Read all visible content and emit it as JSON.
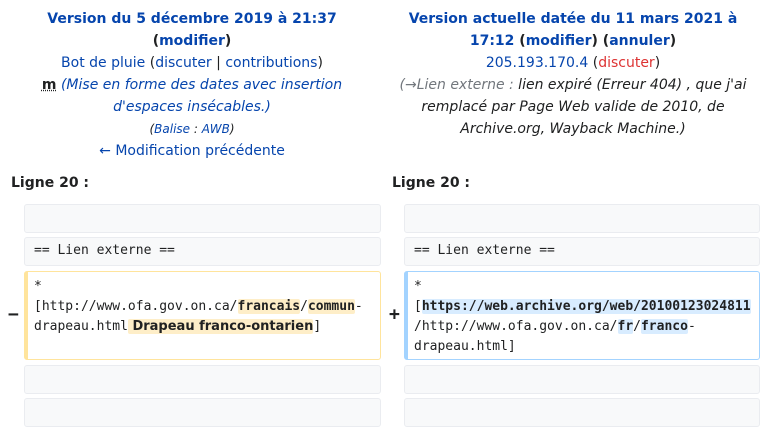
{
  "left": {
    "title": "Version du 5 décembre 2019 à 21:37",
    "modify": "modifier",
    "user": "Bot de pluie",
    "discuss": "discuter",
    "sep": "|",
    "contributions": "contributions",
    "minor": "m",
    "summary_line1": "(Mise en forme des dates avec insertion",
    "summary_line2": "d'espaces insécables.)",
    "tag_prefix": "(",
    "tag_label": "Balise",
    "tag_colon": " : ",
    "tag_name": "AWB",
    "tag_suffix": ")",
    "prev_edit": "← Modification précédente"
  },
  "right": {
    "title_line1": "Version actuelle datée du 11 mars 2021 à",
    "title_line2": "17:12",
    "modify": "modifier",
    "undo": "annuler",
    "ip": "205.193.170.4",
    "discuss": "discuter",
    "summary_line1_section": "(→Lien externe :",
    "summary_line1_rest": " lien expiré (Erreur 404) , que j'ai",
    "summary_line2": "remplacé par Page Web valide de 2010, de",
    "summary_line3": "Archive.org, Wayback Machine.)"
  },
  "diff": {
    "line_label_left": "Ligne 20 :",
    "line_label_right": "Ligne 20 :",
    "ctx_empty": "",
    "ctx_section": "== Lien externe ==",
    "del_marker": "−",
    "add_marker": "+",
    "del": {
      "l1": "*",
      "l2a": "[http://www.ofa.gov.on.ca/",
      "l2b": "francais",
      "l2c": "/",
      "l2d": "commun",
      "l2e": "-",
      "l3a": "drapeau.html",
      "l3b": " Drapeau franco-ontarien",
      "l3c": "]"
    },
    "add": {
      "l1": "*",
      "l2a": "[",
      "l2b": "https://web.archive.org/web/20100123024811",
      "l3a": "/http://www.ofa.gov.on.ca/",
      "l3b": "fr",
      "l3c": "/",
      "l3d": "franco",
      "l3e": "-",
      "l4": "drapeau.html]"
    }
  }
}
